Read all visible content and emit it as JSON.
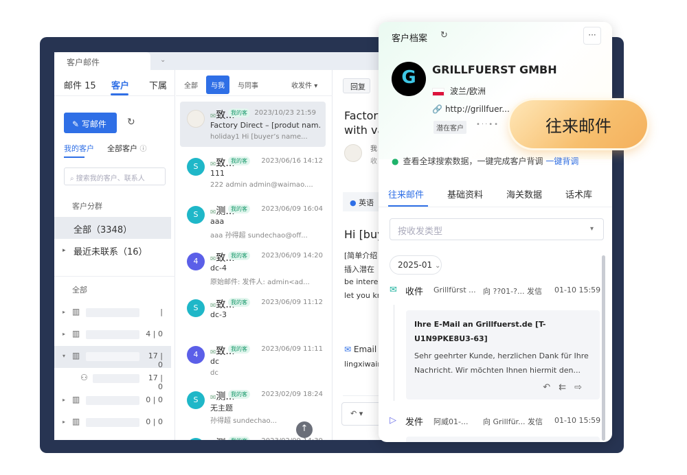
{
  "window_tab": "客户邮件",
  "left": {
    "tabs": [
      "邮件 15",
      "客户",
      "下属"
    ],
    "write_button": "写邮件",
    "subtabs": [
      "我的客户",
      "全部客户"
    ],
    "search_placeholder": "搜索我的客户、联系人",
    "group_label": "客户分群",
    "groups": [
      {
        "label": "全部（3348）"
      },
      {
        "label": "最近未联系（16）"
      }
    ],
    "all_label": "全部",
    "tree_counts": [
      "|",
      "4 | 0",
      "17 | 0",
      "17 | 0",
      "0 | 0",
      "0 | 0"
    ]
  },
  "middle": {
    "tabs": [
      "全部",
      "与我",
      "与同事"
    ],
    "filter": "收发件",
    "badge_text": "我的客",
    "mails": [
      {
        "avatar": "",
        "title": "致...",
        "date": "2023/10/23 21:59",
        "line2": "Factory Direct – [produt nam...",
        "line3": "holiday1 Hi [buyer’s name..."
      },
      {
        "avatar": "S",
        "title": "致...",
        "date": "2023/06/16 14:12",
        "line2": "111",
        "line3": "222 admin admin@waimao...."
      },
      {
        "avatar": "S",
        "title": "测...",
        "date": "2023/06/09 16:04",
        "line2": "aaa",
        "line3": "aaa 孙得超 sundechao@off..."
      },
      {
        "avatar": "4",
        "title": "致...",
        "date": "2023/06/09 14:20",
        "line2": "dc-4",
        "line3": "原始邮件: 发件人: admin<ad..."
      },
      {
        "avatar": "S",
        "title": "致...",
        "date": "2023/06/09 11:12",
        "line2": "dc-3",
        "line3": ""
      },
      {
        "avatar": "4",
        "title": "致...",
        "date": "2023/06/09 11:11",
        "line2": "dc",
        "line3": "dc"
      },
      {
        "avatar": "S",
        "title": "测...",
        "date": "2023/02/09 18:24",
        "line2": "无主题",
        "line3": "孙得超 sundechao..."
      },
      {
        "avatar": "S",
        "title": "测...",
        "date": "2023/02/09 14:39",
        "line2": "",
        "line3": ""
      }
    ]
  },
  "reading": {
    "reply_button": "回复",
    "title_line1": "Factory",
    "title_line2": "with va",
    "sender_short": "我",
    "recv_short": "收",
    "lang_label": "英语",
    "greeting": "Hi [buy",
    "body_lines": [
      "[简单介绍",
      "插入潜在",
      "be interes",
      "let you kn"
    ],
    "email_label": "Email",
    "email_value": "lingxiwair"
  },
  "card": {
    "title": "客户档案",
    "logo_letter": "G",
    "company": "GRILLFUERST GMBH",
    "region": "波兰/欧洲",
    "website": "http://grillfuer...",
    "tag": "潜在客户",
    "status_text": "查看全球搜索数据，一键完成客户背调",
    "status_link": "一键背调",
    "tabs": [
      "往来邮件",
      "基础资料",
      "海关数据",
      "话术库"
    ],
    "filter_placeholder": "按收发类型",
    "month": "2025-01",
    "rows": [
      {
        "type": "收件",
        "from": "Grillfürst ...",
        "to": "向 ??01-?... 发信",
        "date": "01-10 15:59"
      },
      {
        "type": "发件",
        "from": "阿威01-...",
        "to": "向 Grillfür... 发信",
        "date": "01-10 15:59"
      }
    ],
    "mail_subject": "Ihre E-Mail an Grillfuerst.de [T-U1N9PKE8U3-63]",
    "mail_body": "Sehr geehrter Kunde, herzlichen Dank für Ihre Nachricht. Wir möchten Ihnen hiermit den..."
  },
  "highlight": "往来邮件",
  "colors": {
    "accent": "#2f6fe6",
    "frame": "#273452",
    "highlight": "#f7bf6e"
  }
}
